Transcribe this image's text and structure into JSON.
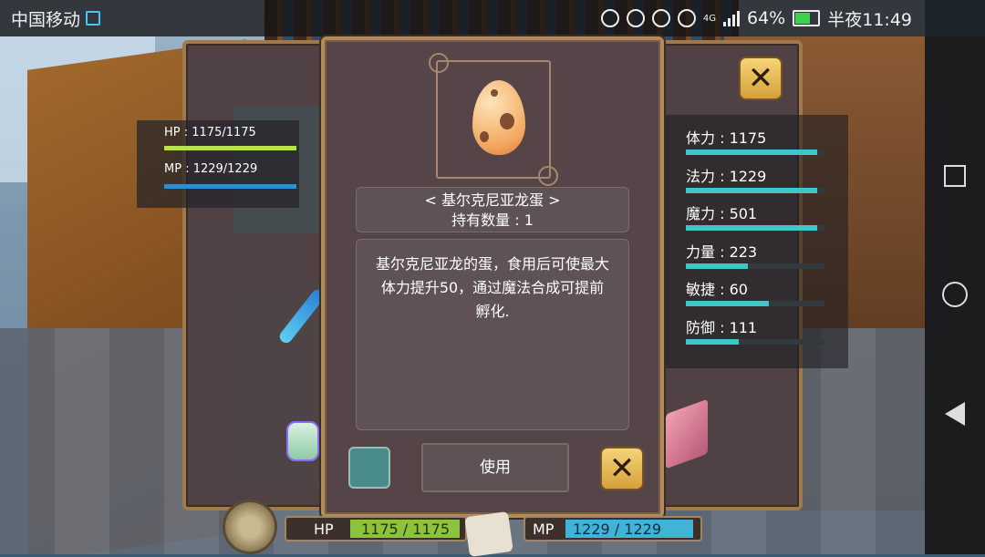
{
  "status_bar": {
    "carrier": "中国移动",
    "network": "4G",
    "battery": "64%",
    "time": "半夜11:49"
  },
  "left_panel": {
    "hp_text": "HP : 1175/1175",
    "mp_text": "MP : 1229/1229"
  },
  "item_detail": {
    "name": "< 基尔克尼亚龙蛋 >",
    "quantity": "持有数量 : 1",
    "description": "基尔克尼亚龙的蛋，食用后可使最大体力提升50，通过魔法合成可提前孵化.",
    "use_label": "使用"
  },
  "stats": [
    {
      "label": "体力 : 1175",
      "fill": 0.95
    },
    {
      "label": "法力 : 1229",
      "fill": 0.95
    },
    {
      "label": "魔力 : 501",
      "fill": 0.95
    },
    {
      "label": "力量 : 223",
      "fill": 0.45
    },
    {
      "label": "敏捷 : 60",
      "fill": 0.6
    },
    {
      "label": "防御 : 111",
      "fill": 0.38
    }
  ],
  "hud": {
    "hp_label": "HP",
    "hp_value": "1175 / 1175",
    "mp_label": "MP",
    "mp_value": "1229 / 1229"
  },
  "colors": {
    "stat_bar": "#3fc6c9",
    "hp_bar": "#b7e24a",
    "mp_bar": "#2f8fcc",
    "close_button": "#f0c25a"
  },
  "icons": {
    "close": "close-icon",
    "egg": "dragon-egg-icon",
    "nav_recent": "square-icon",
    "nav_home": "circle-icon",
    "nav_back": "triangle-back-icon"
  }
}
